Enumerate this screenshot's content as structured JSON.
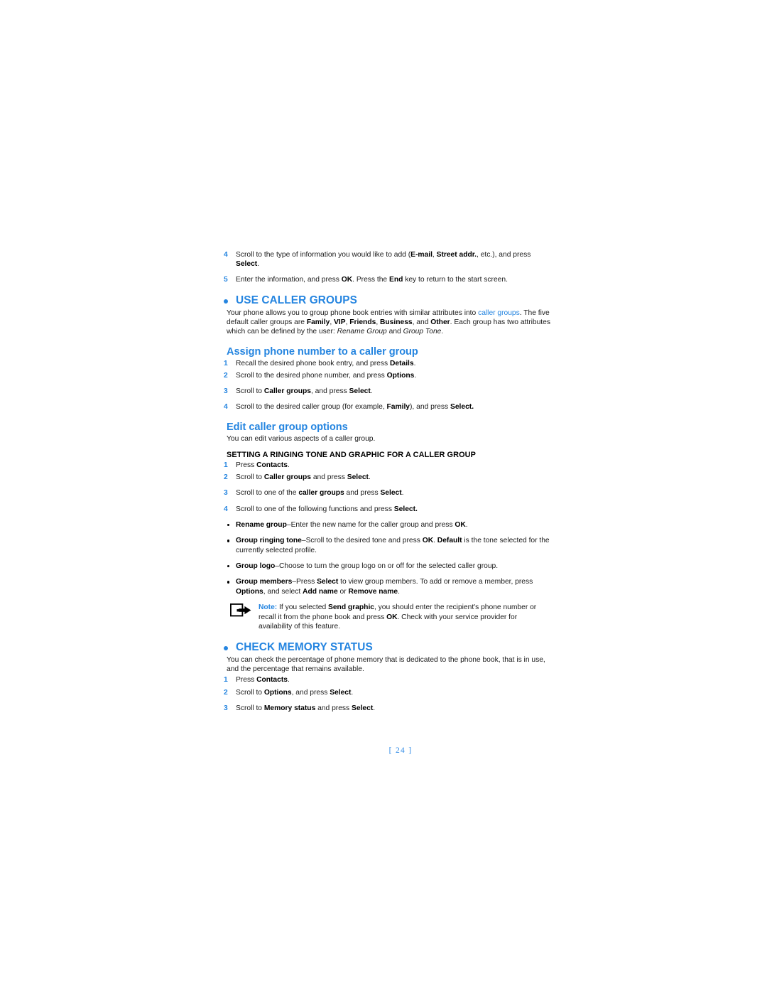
{
  "page": {
    "number_label": "[ 24 ]",
    "accent_blue": "#2585e0",
    "text_color": "#1a1a1a",
    "background": "#ffffff"
  },
  "top_steps": [
    {
      "num": "4",
      "parts": [
        {
          "t": "Scroll to the type of information you would like to add (",
          "s": "n"
        },
        {
          "t": "E-mail",
          "s": "b"
        },
        {
          "t": ", ",
          "s": "n"
        },
        {
          "t": "Street addr.",
          "s": "b"
        },
        {
          "t": ", etc.), and press ",
          "s": "n"
        },
        {
          "t": "Select",
          "s": "b"
        },
        {
          "t": ".",
          "s": "n"
        }
      ]
    },
    {
      "num": "5",
      "parts": [
        {
          "t": "Enter the information, and press ",
          "s": "n"
        },
        {
          "t": "OK",
          "s": "b"
        },
        {
          "t": ". Press the ",
          "s": "n"
        },
        {
          "t": "End",
          "s": "b"
        },
        {
          "t": " key to return to the start screen.",
          "s": "n"
        }
      ]
    }
  ],
  "section_use_caller_groups": {
    "heading": "USE CALLER GROUPS",
    "intro_parts": [
      {
        "t": "Your phone allows you to group phone book entries with similar attributes into ",
        "s": "n"
      },
      {
        "t": "caller groups",
        "s": "link"
      },
      {
        "t": ". The five default caller groups are ",
        "s": "n"
      },
      {
        "t": "Family",
        "s": "b"
      },
      {
        "t": ", ",
        "s": "n"
      },
      {
        "t": "VIP",
        "s": "b"
      },
      {
        "t": ", ",
        "s": "n"
      },
      {
        "t": "Friends",
        "s": "b"
      },
      {
        "t": ", ",
        "s": "n"
      },
      {
        "t": "Business",
        "s": "b"
      },
      {
        "t": ", and ",
        "s": "n"
      },
      {
        "t": "Other",
        "s": "b"
      },
      {
        "t": ". Each group has two attributes which can be defined by the user: ",
        "s": "n"
      },
      {
        "t": "Rename Group",
        "s": "i"
      },
      {
        "t": " and ",
        "s": "n"
      },
      {
        "t": "Group Tone",
        "s": "i"
      },
      {
        "t": ".",
        "s": "n"
      }
    ]
  },
  "subsection_assign": {
    "heading": "Assign phone number to a caller group",
    "steps": [
      {
        "num": "1",
        "parts": [
          {
            "t": "Recall the desired phone book entry, and press ",
            "s": "n"
          },
          {
            "t": "Details",
            "s": "b"
          },
          {
            "t": ".",
            "s": "n"
          }
        ]
      },
      {
        "num": "2",
        "parts": [
          {
            "t": "Scroll to the desired phone number, and press ",
            "s": "n"
          },
          {
            "t": "Options",
            "s": "b"
          },
          {
            "t": ".",
            "s": "n"
          }
        ]
      },
      {
        "num": "3",
        "parts": [
          {
            "t": "Scroll to ",
            "s": "n"
          },
          {
            "t": "Caller groups",
            "s": "b"
          },
          {
            "t": ", and press ",
            "s": "n"
          },
          {
            "t": "Select",
            "s": "b"
          },
          {
            "t": ".",
            "s": "n"
          }
        ]
      },
      {
        "num": "4",
        "parts": [
          {
            "t": "Scroll to the desired caller group (for example, ",
            "s": "n"
          },
          {
            "t": "Family",
            "s": "b"
          },
          {
            "t": "), and press ",
            "s": "n"
          },
          {
            "t": "Select.",
            "s": "b"
          }
        ]
      }
    ]
  },
  "subsection_edit": {
    "heading": "Edit caller group options",
    "intro": "You can edit various aspects of a caller group.",
    "subsub_heading": "SETTING A RINGING TONE AND GRAPHIC FOR A CALLER GROUP",
    "steps": [
      {
        "num": "1",
        "parts": [
          {
            "t": "Press ",
            "s": "n"
          },
          {
            "t": "Contacts",
            "s": "b"
          },
          {
            "t": ".",
            "s": "n"
          }
        ]
      },
      {
        "num": "2",
        "parts": [
          {
            "t": "Scroll to ",
            "s": "n"
          },
          {
            "t": "Caller groups",
            "s": "b"
          },
          {
            "t": " and press ",
            "s": "n"
          },
          {
            "t": "Select",
            "s": "b"
          },
          {
            "t": ".",
            "s": "n"
          }
        ]
      },
      {
        "num": "3",
        "parts": [
          {
            "t": "Scroll to one of the ",
            "s": "n"
          },
          {
            "t": "caller groups",
            "s": "b"
          },
          {
            "t": " and press ",
            "s": "n"
          },
          {
            "t": "Select",
            "s": "b"
          },
          {
            "t": ".",
            "s": "n"
          }
        ]
      },
      {
        "num": "4",
        "parts": [
          {
            "t": "Scroll to one of the following functions and press ",
            "s": "n"
          },
          {
            "t": "Select.",
            "s": "b"
          }
        ]
      }
    ],
    "bullets": [
      {
        "parts": [
          {
            "t": "Rename group",
            "s": "b"
          },
          {
            "t": "–Enter the new name for the caller group and press ",
            "s": "n"
          },
          {
            "t": "OK",
            "s": "b"
          },
          {
            "t": ".",
            "s": "n"
          }
        ]
      },
      {
        "parts": [
          {
            "t": "Group ringing tone",
            "s": "b"
          },
          {
            "t": "–Scroll to the desired tone and press ",
            "s": "n"
          },
          {
            "t": "OK",
            "s": "b"
          },
          {
            "t": ". ",
            "s": "n"
          },
          {
            "t": "Default",
            "s": "b"
          },
          {
            "t": " is the tone selected for the currently selected profile.",
            "s": "n"
          }
        ]
      },
      {
        "parts": [
          {
            "t": "Group logo",
            "s": "b"
          },
          {
            "t": "–Choose to turn the group logo on or off for the selected caller group.",
            "s": "n"
          }
        ]
      },
      {
        "parts": [
          {
            "t": "Group members",
            "s": "b"
          },
          {
            "t": "–Press ",
            "s": "n"
          },
          {
            "t": "Select",
            "s": "b"
          },
          {
            "t": " to view group members. To add or remove a member, press ",
            "s": "n"
          },
          {
            "t": "Options",
            "s": "b"
          },
          {
            "t": ", and select ",
            "s": "n"
          },
          {
            "t": "Add name",
            "s": "b"
          },
          {
            "t": " or ",
            "s": "n"
          },
          {
            "t": "Remove name",
            "s": "b"
          },
          {
            "t": ".",
            "s": "n"
          }
        ]
      }
    ],
    "note": {
      "icon": "note-arrow-icon",
      "label": "Note:",
      "parts": [
        {
          "t": " If you selected ",
          "s": "n"
        },
        {
          "t": "Send graphic",
          "s": "b"
        },
        {
          "t": ", you should enter the recipient's phone number or recall it from the phone book and press ",
          "s": "n"
        },
        {
          "t": "OK",
          "s": "b"
        },
        {
          "t": ". Check with your service provider for availability of this feature.",
          "s": "n"
        }
      ]
    }
  },
  "section_check_memory": {
    "heading": "CHECK MEMORY STATUS",
    "intro": "You can check the percentage of phone memory that is dedicated to the phone book, that is in use, and the percentage that remains available.",
    "steps": [
      {
        "num": "1",
        "parts": [
          {
            "t": "Press ",
            "s": "n"
          },
          {
            "t": "Contacts",
            "s": "b"
          },
          {
            "t": ".",
            "s": "n"
          }
        ]
      },
      {
        "num": "2",
        "parts": [
          {
            "t": "Scroll to ",
            "s": "n"
          },
          {
            "t": "Options",
            "s": "b"
          },
          {
            "t": ", and press ",
            "s": "n"
          },
          {
            "t": "Select",
            "s": "b"
          },
          {
            "t": ".",
            "s": "n"
          }
        ]
      },
      {
        "num": "3",
        "parts": [
          {
            "t": "Scroll to ",
            "s": "n"
          },
          {
            "t": "Memory status",
            "s": "b"
          },
          {
            "t": " and press ",
            "s": "n"
          },
          {
            "t": "Select",
            "s": "b"
          },
          {
            "t": ".",
            "s": "n"
          }
        ]
      }
    ]
  }
}
